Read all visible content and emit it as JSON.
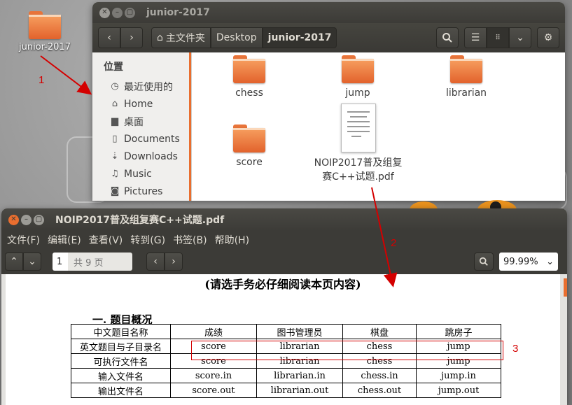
{
  "desktop": {
    "icon_label": "junior-2017",
    "annotations": [
      "1",
      "2",
      "3"
    ]
  },
  "file_manager": {
    "title": "junior-2017",
    "breadcrumbs": [
      "主文件夹",
      "Desktop",
      "junior-2017"
    ],
    "sidebar": {
      "heading": "位置",
      "items": [
        {
          "icon": "clock-icon",
          "label": "最近使用的"
        },
        {
          "icon": "home-icon",
          "label": "Home"
        },
        {
          "icon": "folder-icon",
          "label": "桌面"
        },
        {
          "icon": "document-icon",
          "label": "Documents"
        },
        {
          "icon": "download-icon",
          "label": "Downloads"
        },
        {
          "icon": "music-icon",
          "label": "Music"
        },
        {
          "icon": "camera-icon",
          "label": "Pictures"
        }
      ]
    },
    "items": [
      {
        "type": "folder",
        "label": "chess"
      },
      {
        "type": "folder",
        "label": "jump"
      },
      {
        "type": "folder",
        "label": "librarian"
      },
      {
        "type": "folder",
        "label": "score"
      },
      {
        "type": "pdf",
        "label_line1": "NOIP2017普及组复",
        "label_line2": "赛C++试题.pdf"
      }
    ]
  },
  "pdf_viewer": {
    "title": "NOIP2017普及组复赛C++试题.pdf",
    "menu": [
      "文件(F)",
      "编辑(E)",
      "查看(V)",
      "转到(G)",
      "书签(B)",
      "帮助(H)"
    ],
    "page_current": "1",
    "page_total": "共 9 页",
    "zoom": "99.99%",
    "notice": "(请选手务必仔细阅读本页内容)",
    "section_title": "一. 题目概况",
    "table": {
      "rows": [
        [
          "中文题目名称",
          "成绩",
          "图书管理员",
          "棋盘",
          "跳房子"
        ],
        [
          "英文题目与子目录名",
          "score",
          "librarian",
          "chess",
          "jump"
        ],
        [
          "可执行文件名",
          "score",
          "librarian",
          "chess",
          "jump"
        ],
        [
          "输入文件名",
          "score.in",
          "librarian.in",
          "chess.in",
          "jump.in"
        ],
        [
          "输出文件名",
          "score.out",
          "librarian.out",
          "chess.out",
          "jump.out"
        ]
      ]
    }
  },
  "colors": {
    "accent_orange": "#e96e2f",
    "annotation_red": "#d40000",
    "titlebar": "#3c3b37"
  }
}
